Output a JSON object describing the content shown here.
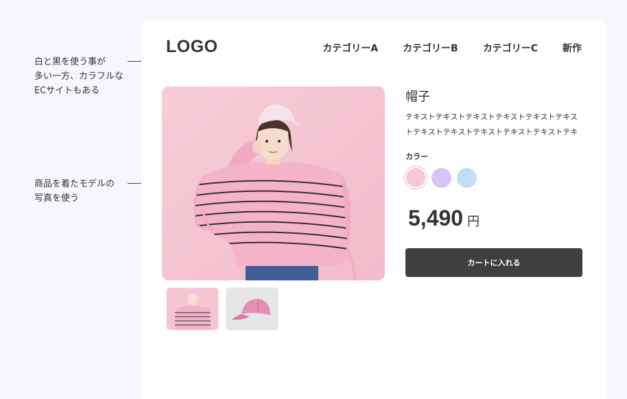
{
  "annotations": {
    "colors": "白と黒を使う事が\n多い一方、カラフルな\nECサイトもある",
    "photo": "商品を着たモデルの\n写真を使う"
  },
  "header": {
    "logo": "LOGO",
    "nav": [
      "カテゴリーA",
      "カテゴリーB",
      "カテゴリーC",
      "新作"
    ]
  },
  "product": {
    "title": "帽子",
    "description": "テキストテキストテキストテキストテキストテキストテキストテキストテキストテキストテキストテキ",
    "color_label": "カラー",
    "colors": [
      {
        "name": "pink",
        "hex": "#f7c6dc",
        "selected": true
      },
      {
        "name": "lavender",
        "hex": "#d6c6f5",
        "selected": false
      },
      {
        "name": "light-blue",
        "hex": "#c5def7",
        "selected": false
      }
    ],
    "price": "5,490",
    "price_unit": "円",
    "cart_label": "カートに入れる"
  },
  "images": {
    "main": "model-in-pink-striped-sweater",
    "thumbs": [
      "model-in-pink-striped-sweater",
      "pink-cap"
    ]
  }
}
